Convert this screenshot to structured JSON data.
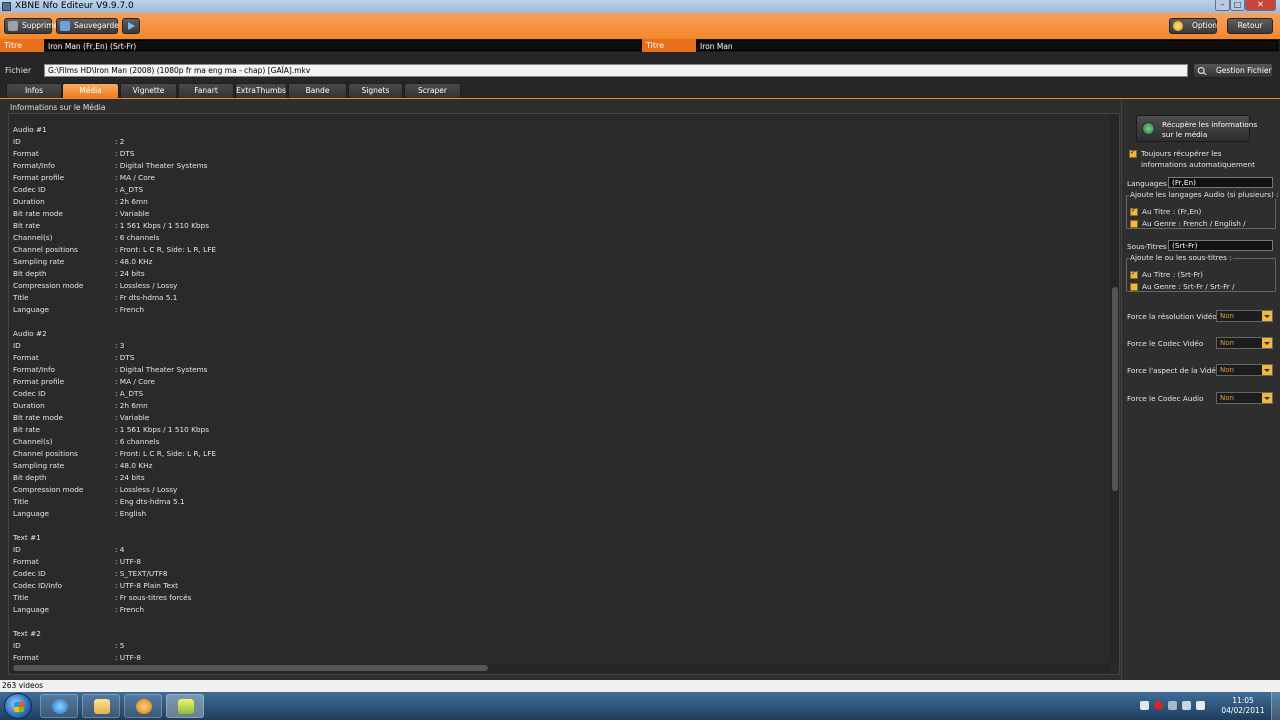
{
  "window": {
    "title": "XBNE Nfo Editeur V9.9.7.0"
  },
  "toolbar": {
    "supprime": "Supprime",
    "sauvegarde": "Sauvegarde",
    "option": "Option",
    "retour": "Retour"
  },
  "titre": {
    "label": "Titre",
    "value": "Iron Man (Fr,En) (Srt-Fr)",
    "original_label": "Titre Original",
    "original_value": "Iron Man"
  },
  "fichier": {
    "label": "Fichier",
    "value": "G:\\Films HD\\Iron Man (2008) (1080p fr ma eng ma - chap) [GAÏA].mkv",
    "gestion": "Gestion Fichier"
  },
  "tabs": [
    {
      "label": "Infos",
      "active": false
    },
    {
      "label": "Média",
      "active": true
    },
    {
      "label": "Vignette",
      "active": false
    },
    {
      "label": "Fanart",
      "active": false
    },
    {
      "label": "ExtraThumbs",
      "active": false
    },
    {
      "label": "Bande Annonce",
      "active": false
    },
    {
      "label": "Signets",
      "active": false
    },
    {
      "label": "Scraper",
      "active": false
    }
  ],
  "media": {
    "heading": "Informations sur le Média",
    "lines": [
      {
        "k": "Audio #1",
        "v": ""
      },
      {
        "k": "ID",
        "v": ": 2"
      },
      {
        "k": "Format",
        "v": ": DTS"
      },
      {
        "k": "Format/Info",
        "v": ": Digital Theater Systems"
      },
      {
        "k": "Format profile",
        "v": ": MA / Core"
      },
      {
        "k": "Codec ID",
        "v": ": A_DTS"
      },
      {
        "k": "Duration",
        "v": ": 2h 6mn"
      },
      {
        "k": "Bit rate mode",
        "v": ": Variable"
      },
      {
        "k": "Bit rate",
        "v": ": 1 561 Kbps / 1 510 Kbps"
      },
      {
        "k": "Channel(s)",
        "v": ": 6 channels"
      },
      {
        "k": "Channel positions",
        "v": ": Front: L C R, Side: L R, LFE"
      },
      {
        "k": "Sampling rate",
        "v": ": 48.0 KHz"
      },
      {
        "k": "Bit depth",
        "v": ": 24 bits"
      },
      {
        "k": "Compression mode",
        "v": ": Lossless / Lossy"
      },
      {
        "k": "Title",
        "v": ": Fr dts-hdma 5.1"
      },
      {
        "k": "Language",
        "v": ": French"
      },
      {
        "k": "",
        "v": ""
      },
      {
        "k": "Audio #2",
        "v": ""
      },
      {
        "k": "ID",
        "v": ": 3"
      },
      {
        "k": "Format",
        "v": ": DTS"
      },
      {
        "k": "Format/Info",
        "v": ": Digital Theater Systems"
      },
      {
        "k": "Format profile",
        "v": ": MA / Core"
      },
      {
        "k": "Codec ID",
        "v": ": A_DTS"
      },
      {
        "k": "Duration",
        "v": ": 2h 6mn"
      },
      {
        "k": "Bit rate mode",
        "v": ": Variable"
      },
      {
        "k": "Bit rate",
        "v": ": 1 561 Kbps / 1 510 Kbps"
      },
      {
        "k": "Channel(s)",
        "v": ": 6 channels"
      },
      {
        "k": "Channel positions",
        "v": ": Front: L C R, Side: L R, LFE"
      },
      {
        "k": "Sampling rate",
        "v": ": 48.0 KHz"
      },
      {
        "k": "Bit depth",
        "v": ": 24 bits"
      },
      {
        "k": "Compression mode",
        "v": ": Lossless / Lossy"
      },
      {
        "k": "Title",
        "v": ": Eng dts-hdma 5.1"
      },
      {
        "k": "Language",
        "v": ": English"
      },
      {
        "k": "",
        "v": ""
      },
      {
        "k": "Text #1",
        "v": ""
      },
      {
        "k": "ID",
        "v": ": 4"
      },
      {
        "k": "Format",
        "v": ": UTF-8"
      },
      {
        "k": "Codec ID",
        "v": ": S_TEXT/UTF8"
      },
      {
        "k": "Codec ID/Info",
        "v": ": UTF-8 Plain Text"
      },
      {
        "k": "Title",
        "v": ": Fr sous-titres forcés"
      },
      {
        "k": "Language",
        "v": ": French"
      },
      {
        "k": "",
        "v": ""
      },
      {
        "k": "Text #2",
        "v": ""
      },
      {
        "k": "ID",
        "v": ": 5"
      },
      {
        "k": "Format",
        "v": ": UTF-8"
      }
    ]
  },
  "panel": {
    "recup_line1": "Récupère les informations",
    "recup_line2": "sur le média",
    "toujours_line1": "Toujours récupérer les",
    "toujours_line2": "informations automatiquement",
    "languages_label": "Languages",
    "languages_value": "(Fr,En)",
    "audio_group_legend": "Ajoute les langages Audio (si plusieurs) :",
    "audio_titre": "Au Titre : (Fr,En)",
    "audio_genre": "Au Genre : French / English /",
    "soustitres_label": "Sous-Titres",
    "soustitres_value": "(Srt-Fr)",
    "sub_group_legend": "Ajoute le ou les sous-titres :",
    "sub_titre": "Au Titre : (Srt-Fr)",
    "sub_genre": "Au Genre : Srt-Fr / Srt-Fr /",
    "force_res_label": "Force la résolution Vidéo",
    "force_res_value": "Non",
    "force_codec_video_label": "Force le Codec Vidéo",
    "force_codec_video_value": "Non",
    "force_aspect_label": "Force l'aspect de la Vidéo",
    "force_aspect_value": "Non",
    "force_codec_audio_label": "Force le Codec Audio",
    "force_codec_audio_value": "Non"
  },
  "status": {
    "text": "263 videos"
  },
  "clock": {
    "time": "11:05",
    "date": "04/02/2011"
  },
  "colors": {
    "accent": "#f3882a",
    "checkbox": "#f3b73f",
    "background": "#2b2b2b"
  }
}
